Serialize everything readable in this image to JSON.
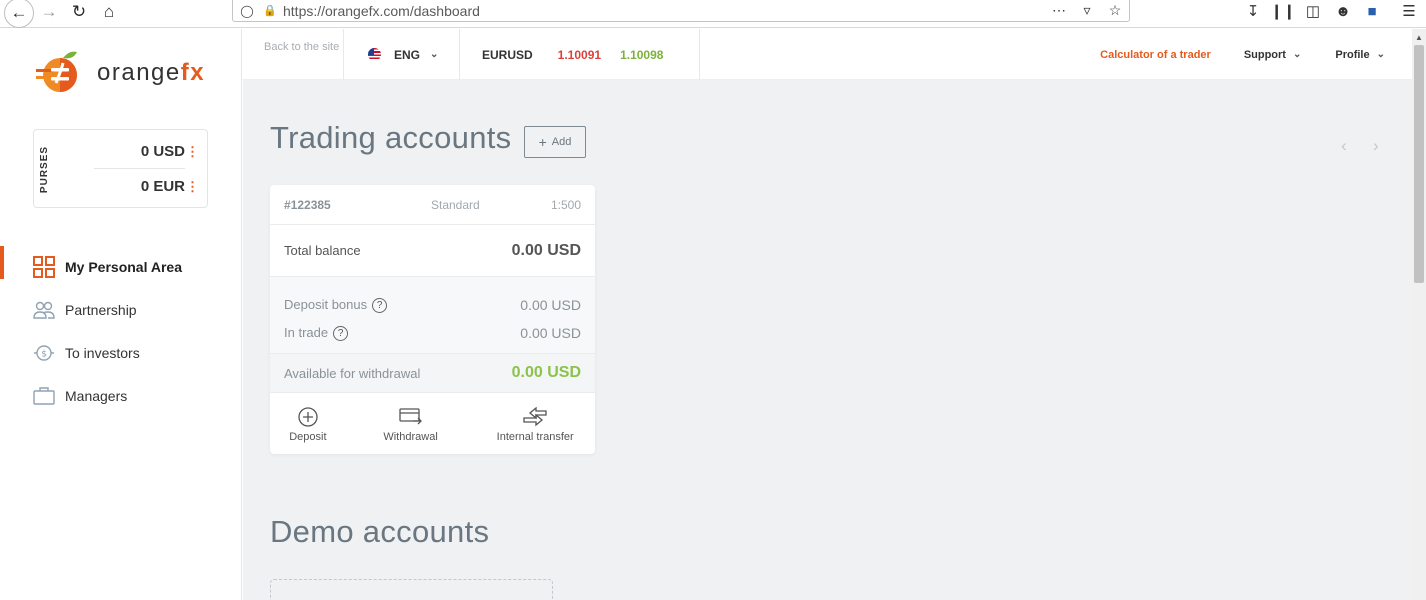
{
  "browser": {
    "url": "https://orangefx.com/dashboard"
  },
  "logo": {
    "text_main": "orange",
    "text_accent": "fx"
  },
  "purses": {
    "label": "PURSES",
    "items": [
      {
        "amount": "0 USD"
      },
      {
        "amount": "0 EUR"
      }
    ],
    "menu_glyph": "⋮"
  },
  "menu": {
    "items": [
      {
        "label": "My Personal Area",
        "icon": "grid-icon",
        "active": true
      },
      {
        "label": "Partnership",
        "icon": "people-icon",
        "active": false
      },
      {
        "label": "To investors",
        "icon": "investor-icon",
        "active": false
      },
      {
        "label": "Managers",
        "icon": "briefcase-icon",
        "active": false
      }
    ]
  },
  "appbar": {
    "back_to_site": "Back to the site",
    "language": "ENG",
    "quote": {
      "symbol": "EURUSD",
      "bid": "1.10091",
      "ask": "1.10098"
    },
    "calculator": "Calculator of a trader",
    "support": "Support",
    "profile": "Profile"
  },
  "trading": {
    "title": "Trading accounts",
    "add_label": "Add",
    "account": {
      "id": "#122385",
      "type": "Standard",
      "leverage": "1:500",
      "total_balance_label": "Total balance",
      "total_balance": "0.00 USD",
      "deposit_bonus_label": "Deposit bonus",
      "deposit_bonus": "0.00 USD",
      "in_trade_label": "In trade",
      "in_trade": "0.00 USD",
      "available_label": "Available for withdrawal",
      "available": "0.00 USD"
    },
    "actions": {
      "deposit": "Deposit",
      "withdrawal": "Withdrawal",
      "transfer": "Internal transfer"
    }
  },
  "demo": {
    "title": "Demo accounts"
  },
  "colors": {
    "brand": "#e45b1d",
    "bid": "#d9403a",
    "ask": "#7cb23a",
    "available": "#8bc34a"
  }
}
